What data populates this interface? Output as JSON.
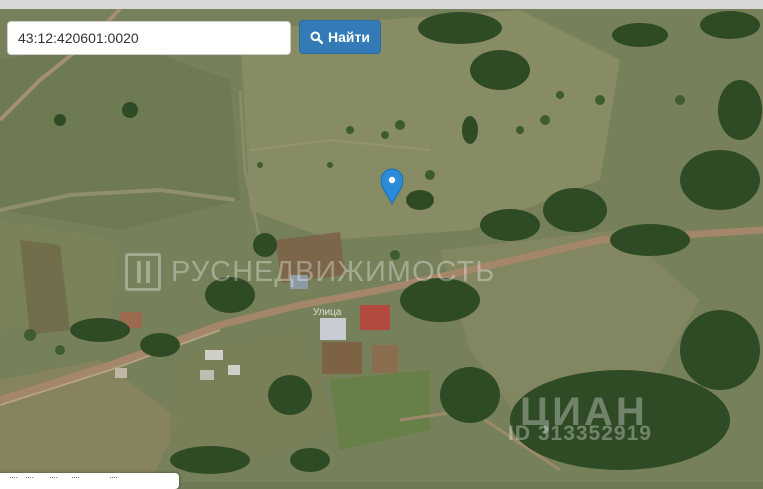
{
  "search": {
    "value": "43:12:420601:0020",
    "placeholder": "",
    "button_label": "Найти",
    "button_icon": "search-icon"
  },
  "map": {
    "imagery": "satellite",
    "marker_icon": "map-pin-icon",
    "street_label": "Улица",
    "watermark_text": "РУСНЕДВИЖИМОСТЬ",
    "watermark_logo": "rusnedvizhimost-logo",
    "cian_watermark_text": "ЦИАН",
    "cian_watermark_id": "ID 313352919"
  },
  "colors": {
    "button": "#337ab7",
    "marker": "#2a8cd8",
    "field_light": "#8a8c66",
    "field_dark": "#6a744e",
    "trees": "#2d4a24",
    "road": "#a4876a"
  }
}
